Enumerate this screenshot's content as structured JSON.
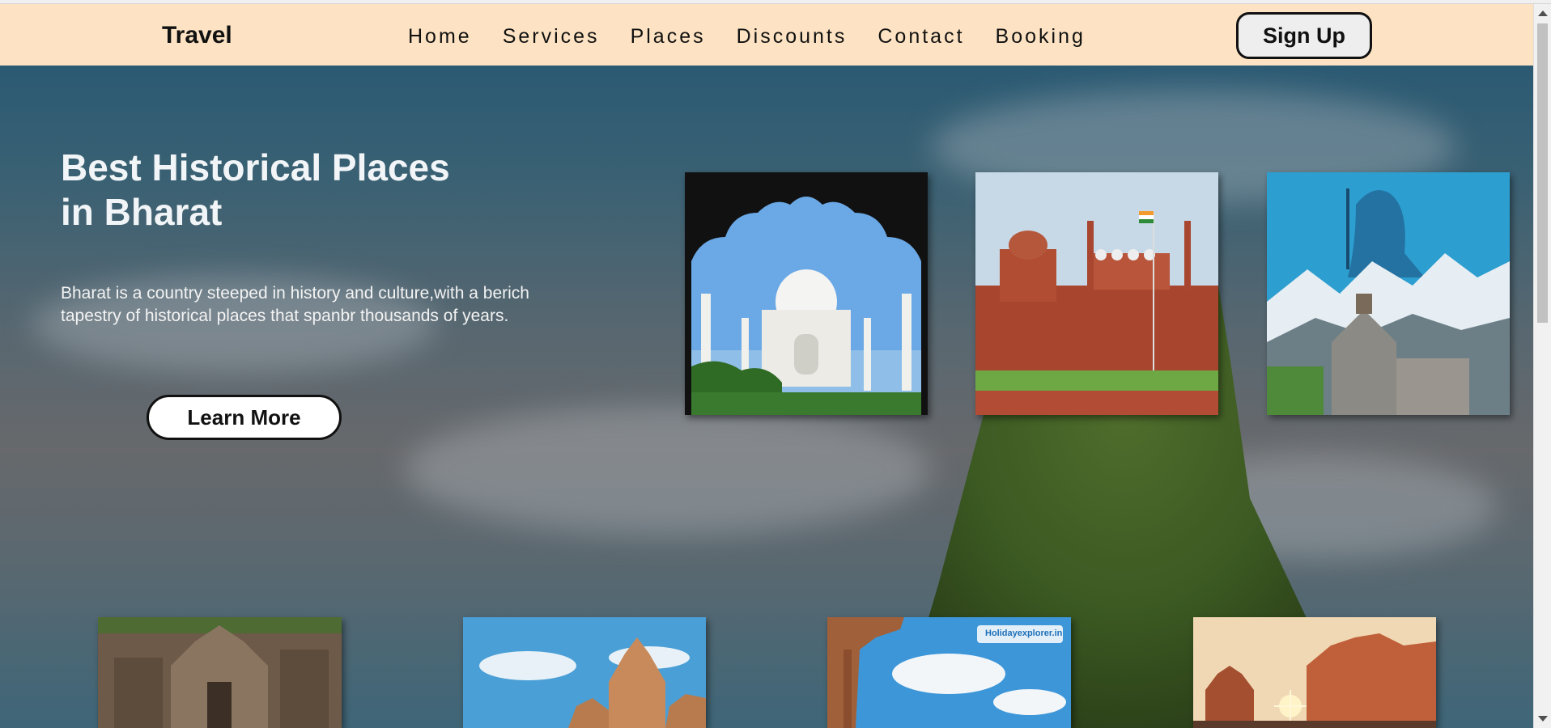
{
  "navbar": {
    "brand": "Travel",
    "links": [
      "Home",
      "Services",
      "Places",
      "Discounts",
      "Contact",
      "Booking"
    ],
    "signup_label": "Sign Up"
  },
  "hero": {
    "title_line1": "Best Historical Places",
    "title_line2": "in Bharat",
    "description": "Bharat is a country steeped in history and culture,with a berich tapestry of historical places that spanbr thousands of years.",
    "learn_more_label": "Learn More"
  },
  "gallery_top": [
    {
      "place": "taj-mahal"
    },
    {
      "place": "red-fort"
    },
    {
      "place": "kedarnath"
    }
  ],
  "gallery_bottom": [
    {
      "place": "rock-cut-temple"
    },
    {
      "place": "khajuraho-temple"
    },
    {
      "place": "stone-monument",
      "watermark": "Holidayexplorer.in"
    },
    {
      "place": "hawa-mahal"
    }
  ],
  "colors": {
    "navbar_bg": "#fde3c3",
    "hero_text": "#f1f5f7"
  }
}
